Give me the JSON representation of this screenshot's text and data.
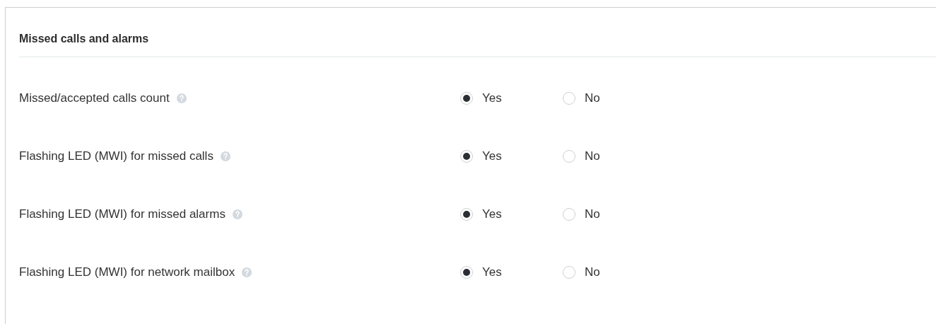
{
  "section": {
    "title": "Missed calls and alarms"
  },
  "settings": [
    {
      "label": "Missed/accepted calls count",
      "options": [
        {
          "label": "Yes",
          "selected": true
        },
        {
          "label": "No",
          "selected": false
        }
      ]
    },
    {
      "label": "Flashing LED (MWI) for missed calls",
      "options": [
        {
          "label": "Yes",
          "selected": true
        },
        {
          "label": "No",
          "selected": false
        }
      ]
    },
    {
      "label": "Flashing LED (MWI) for missed alarms",
      "options": [
        {
          "label": "Yes",
          "selected": true
        },
        {
          "label": "No",
          "selected": false
        }
      ]
    },
    {
      "label": "Flashing LED (MWI) for network mailbox",
      "options": [
        {
          "label": "Yes",
          "selected": true
        },
        {
          "label": "No",
          "selected": false
        }
      ]
    }
  ]
}
